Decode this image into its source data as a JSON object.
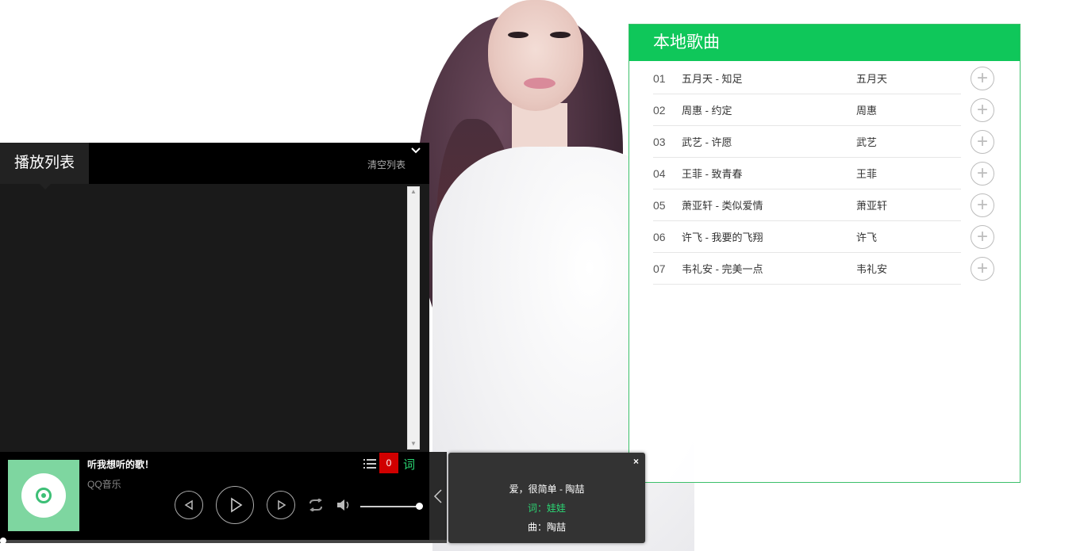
{
  "local_panel": {
    "title": "本地歌曲",
    "songs": [
      {
        "num": "01",
        "title": "五月天 - 知足",
        "artist": "五月天"
      },
      {
        "num": "02",
        "title": "周惠 - 约定",
        "artist": "周惠"
      },
      {
        "num": "03",
        "title": "武艺 - 许愿",
        "artist": "武艺"
      },
      {
        "num": "04",
        "title": "王菲 - 致青春",
        "artist": "王菲"
      },
      {
        "num": "05",
        "title": "萧亚轩 - 类似爱情",
        "artist": "萧亚轩"
      },
      {
        "num": "06",
        "title": "许飞 - 我要的飞翔",
        "artist": "许飞"
      },
      {
        "num": "07",
        "title": "韦礼安 - 完美一点",
        "artist": "韦礼安"
      }
    ],
    "add_icon": "+"
  },
  "playlist": {
    "tab_label": "播放列表",
    "clear_label": "清空列表",
    "collapse_icon": "chevron-down-icon"
  },
  "player": {
    "song_name": "听我想听的歌！",
    "song_sub": "QQ音乐",
    "count": "0",
    "lyric_label": "词",
    "accent_color": "#0fc75a",
    "badge_color": "#d00000"
  },
  "lyrics_popup": {
    "close": "×",
    "line1": "爱，很简单 - 陶喆",
    "line2": "词：娃娃",
    "line3": "曲：陶喆"
  }
}
